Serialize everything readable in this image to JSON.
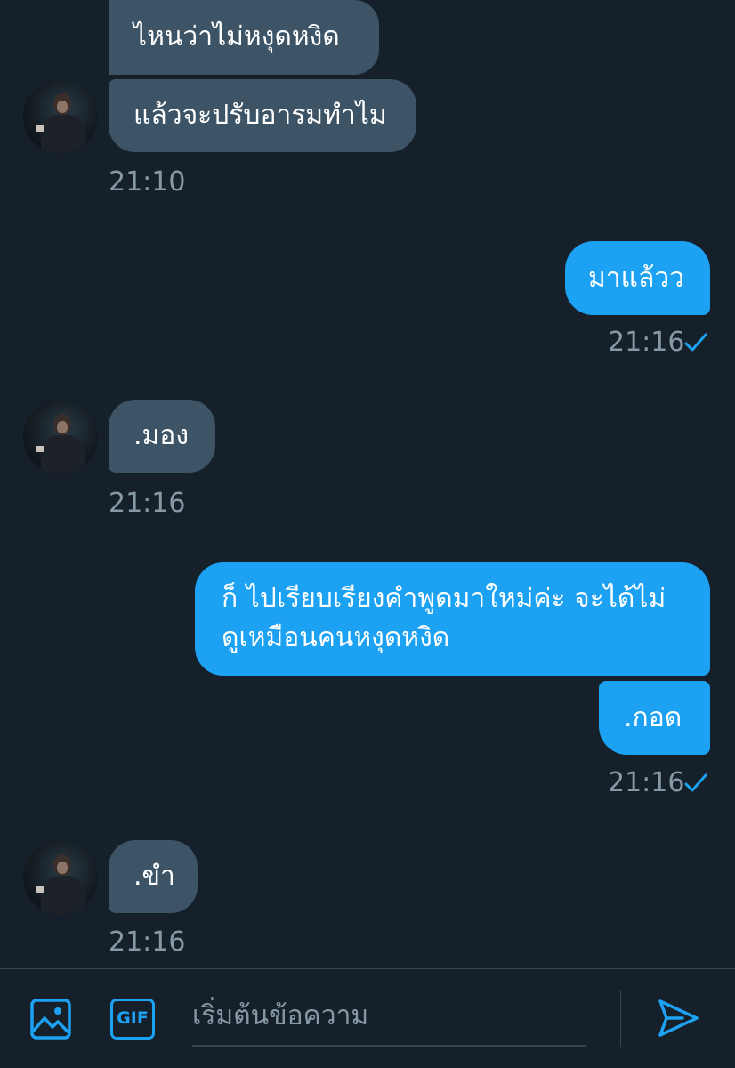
{
  "colors": {
    "background": "#15202b",
    "incoming_bubble": "#3d5466",
    "outgoing_bubble": "#1da1f2",
    "timestamp": "#8899a6",
    "accent": "#1da1f2"
  },
  "messages": [
    {
      "direction": "incoming",
      "text": "ไหนว่าไม่หงุดหงิด"
    },
    {
      "direction": "incoming",
      "text": "แล้วจะปรับอารมทำไม",
      "time": "21:10"
    },
    {
      "direction": "outgoing",
      "text": "มาแล้วว",
      "time": "21:16",
      "status_icon": "check-icon"
    },
    {
      "direction": "incoming",
      "text": ".มอง",
      "time": "21:16"
    },
    {
      "direction": "outgoing",
      "text_lines": [
        "ก็ ไปเรียบเรียงคำพูดมาใหม่ค่ะ จะได้ไม่",
        "ดูเหมือนคนหงุดหงิด"
      ]
    },
    {
      "direction": "outgoing",
      "text": ".กอด",
      "time": "21:16",
      "status_icon": "check-icon"
    },
    {
      "direction": "incoming",
      "text": ".ขำ",
      "time": "21:16"
    }
  ],
  "composer": {
    "placeholder": "เริ่มต้นข้อความ",
    "gif_label": "GIF",
    "icons": [
      "image-icon",
      "gif-icon",
      "send-icon"
    ]
  }
}
